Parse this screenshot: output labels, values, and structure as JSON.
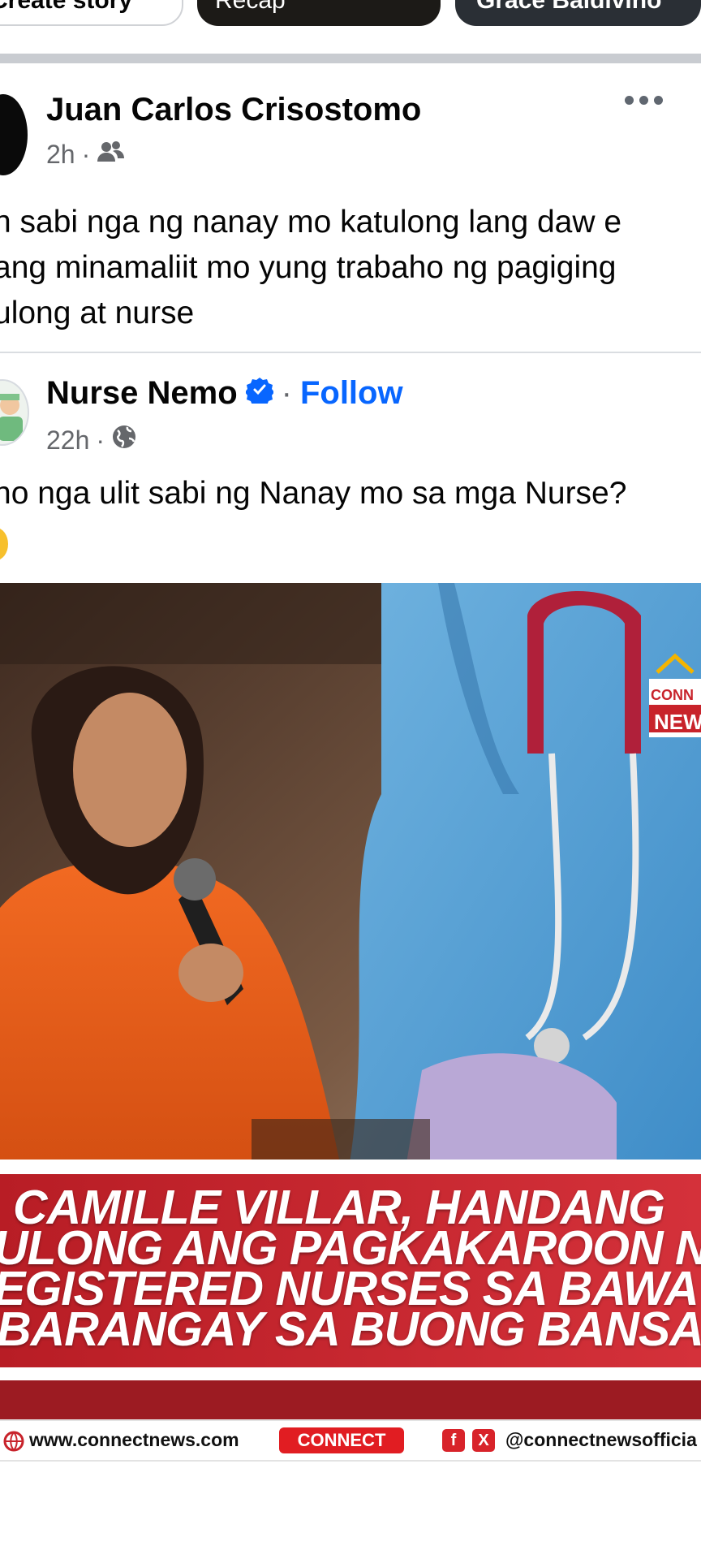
{
  "stories": {
    "create_label": "Create story",
    "items": [
      "Recap",
      "Grace Baldivino"
    ]
  },
  "post": {
    "author": "Juan Carlos Crisostomo",
    "time": "2h",
    "text_lines": [
      "h sabi nga ng nanay mo katulong lang daw e",
      "ang minamaliit mo yung trabaho ng pagiging",
      "ulong at nurse"
    ]
  },
  "shared_post": {
    "author": "Nurse Nemo",
    "follow_label": "Follow",
    "time": "22h",
    "text": "no nga ulit sabi ng Nanay mo sa mga Nurse?",
    "image": {
      "watermark_top": "CONN",
      "watermark_bottom": "NEW",
      "headline_lines": [
        "CAMILLE VILLAR, HANDANG",
        "ULONG ANG PAGKAKAROON N",
        "EGISTERED NURSES SA BAWA",
        "BARANGAY SA BUONG BANSA"
      ],
      "website": "www.connectnews.com",
      "brand": "CONNECT",
      "social_handle": "@connectnewsofficia"
    }
  },
  "colors": {
    "link": "#0866ff",
    "verified": "#0866ff",
    "meta": "#65676b",
    "banner_red": "#c8232b"
  },
  "icons": {
    "audience_friends": "friends-icon",
    "audience_public": "globe-icon",
    "verified": "verified-badge-icon",
    "more": "more-options-icon"
  }
}
